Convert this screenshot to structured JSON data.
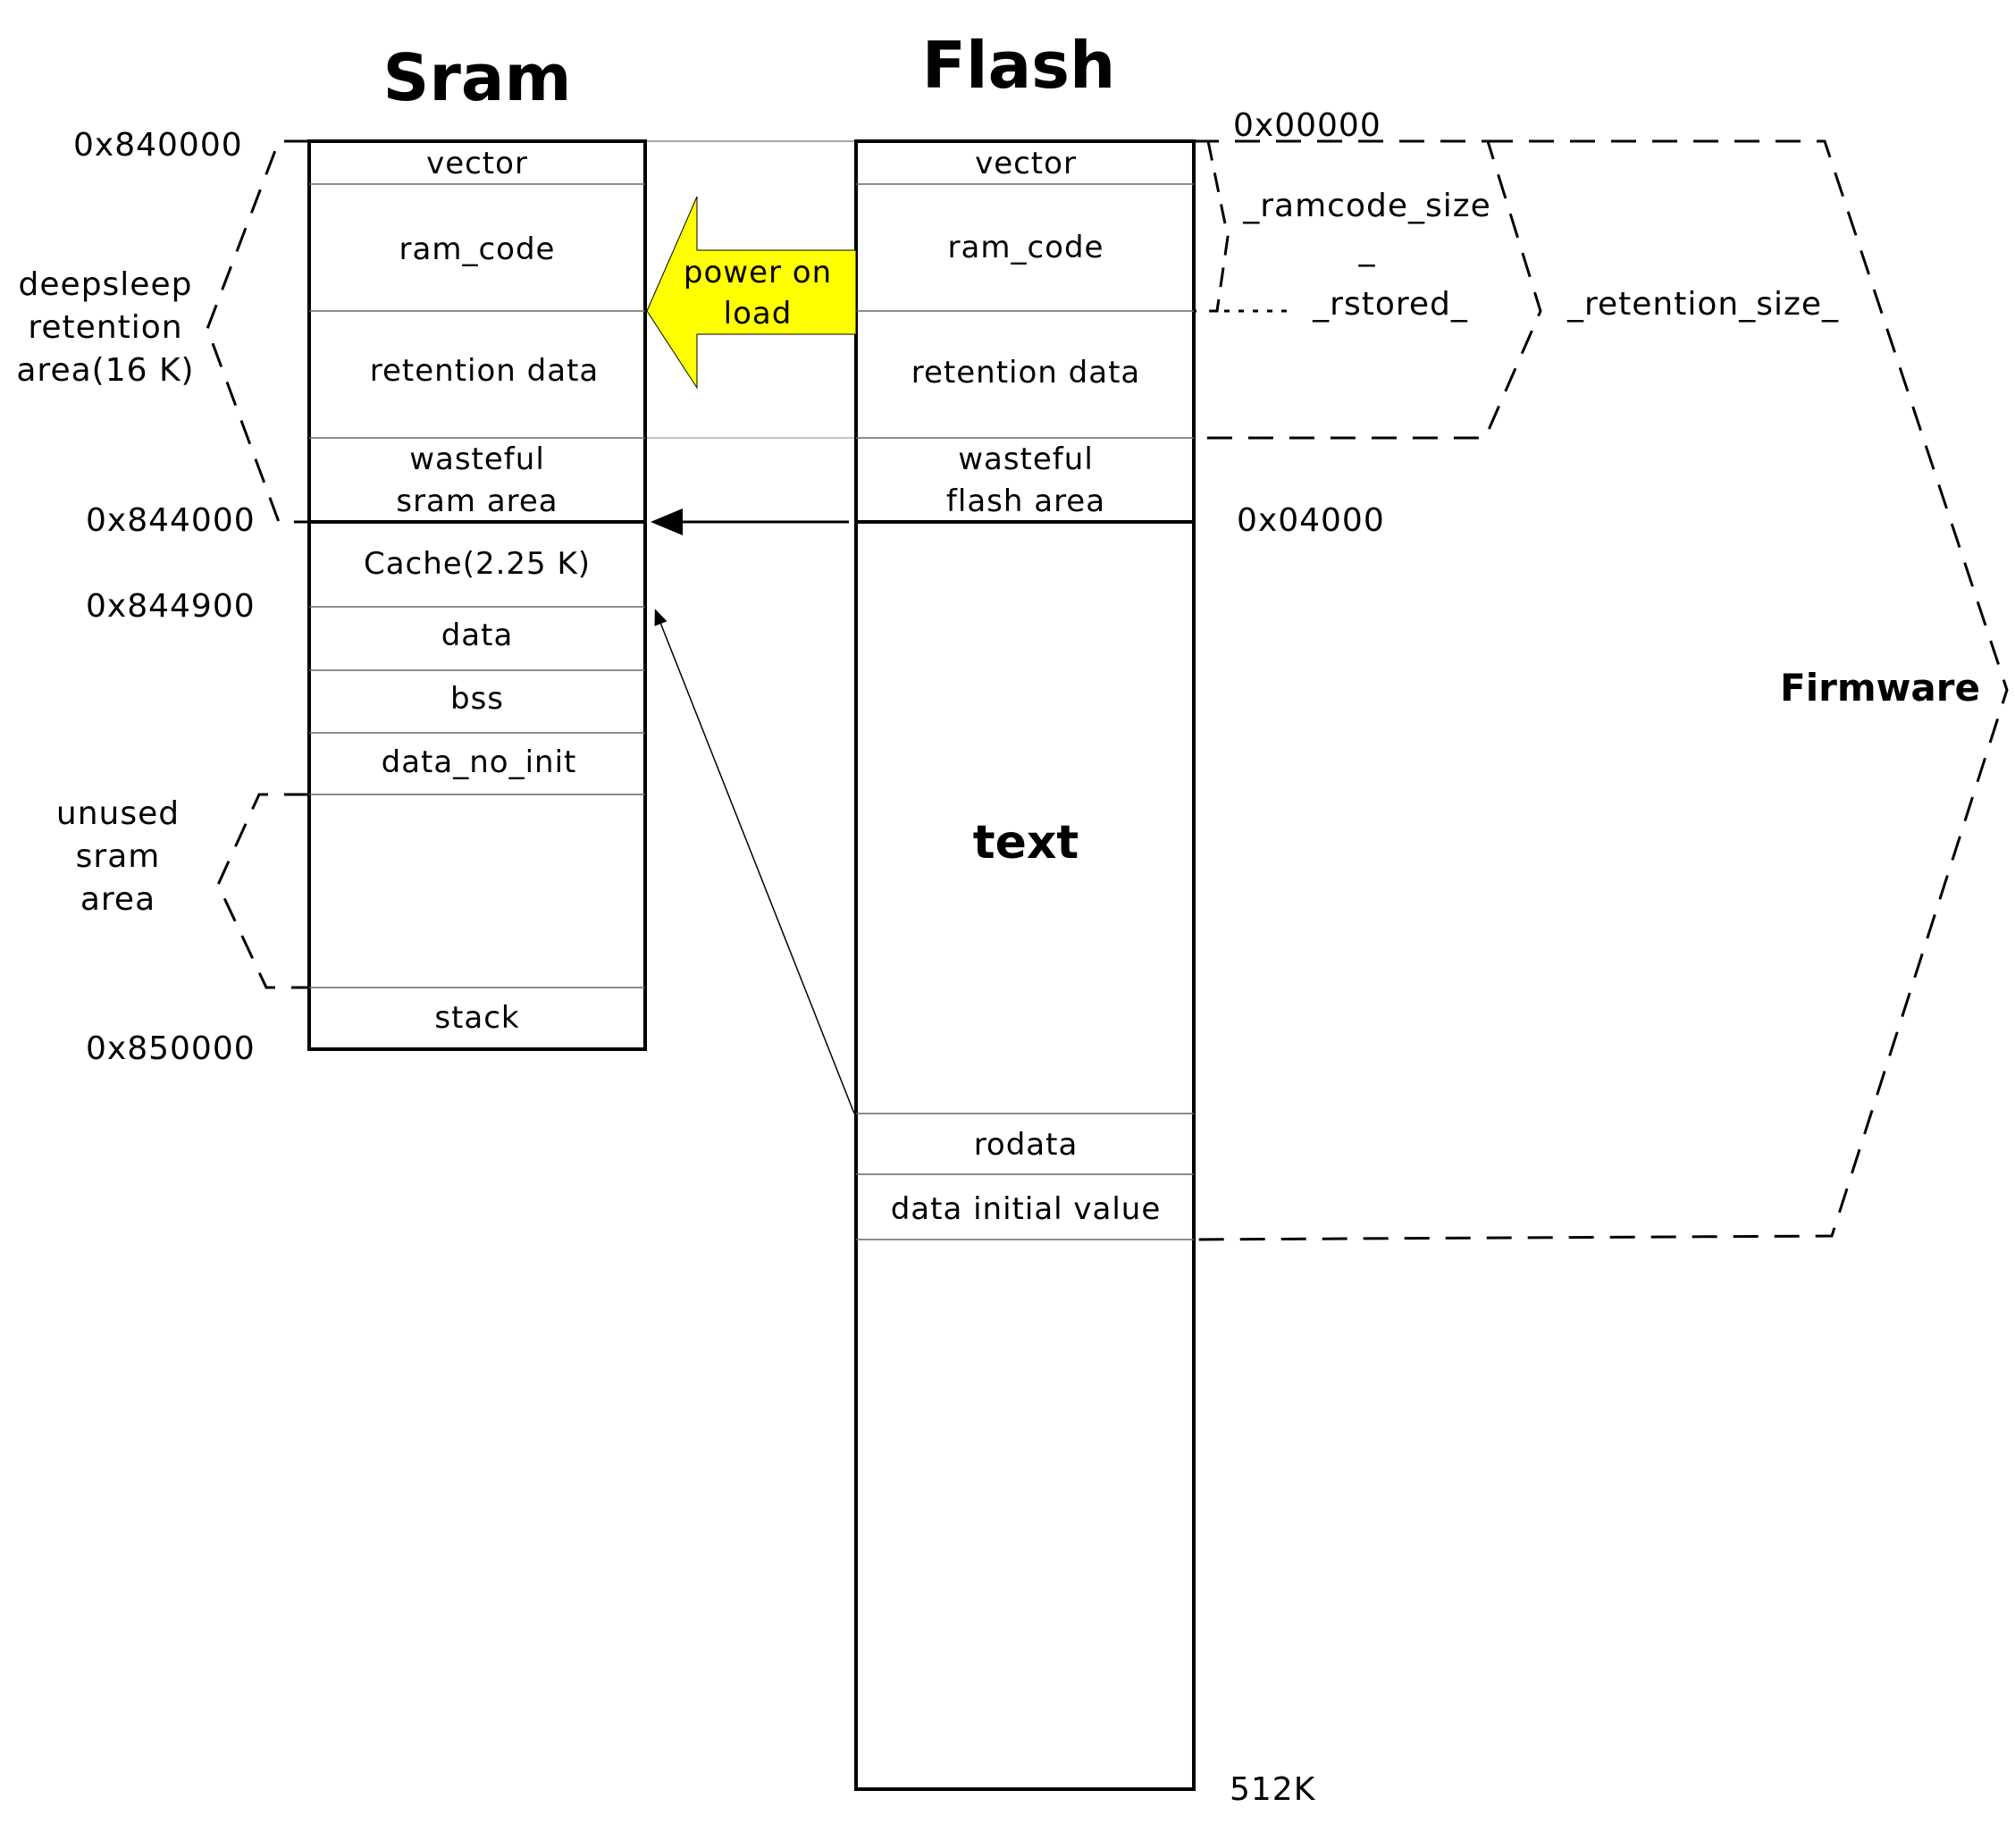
{
  "titles": {
    "sram": "Sram",
    "flash": "Flash"
  },
  "sram": {
    "sections": [
      "vector",
      "ram_code",
      "retention data",
      "wasteful",
      "sram area",
      "Cache(2.25 K)",
      "data",
      "bss",
      "data_no_init",
      "stack"
    ],
    "addresses": [
      "0x840000",
      "0x844000",
      "0x844900",
      "0x850000"
    ],
    "labels": {
      "retention": [
        "deepsleep",
        "retention",
        "area(16 K)"
      ],
      "unused": [
        "unused",
        "sram",
        "area"
      ]
    }
  },
  "flash": {
    "sections": [
      "vector",
      "ram_code",
      "retention data",
      "wasteful",
      "flash area",
      "text",
      "rodata",
      "data initial value"
    ],
    "addresses": [
      "0x00000",
      "0x04000",
      "512K"
    ]
  },
  "arrow": {
    "label_line1": "power on",
    "label_line2": "load",
    "color": "#ffff00"
  },
  "symbols": {
    "ramcode_size": "_ramcode_size",
    "underscore": "_",
    "rstored": "_rstored_",
    "retention_size": "_retention_size_",
    "firmware": "Firmware"
  }
}
